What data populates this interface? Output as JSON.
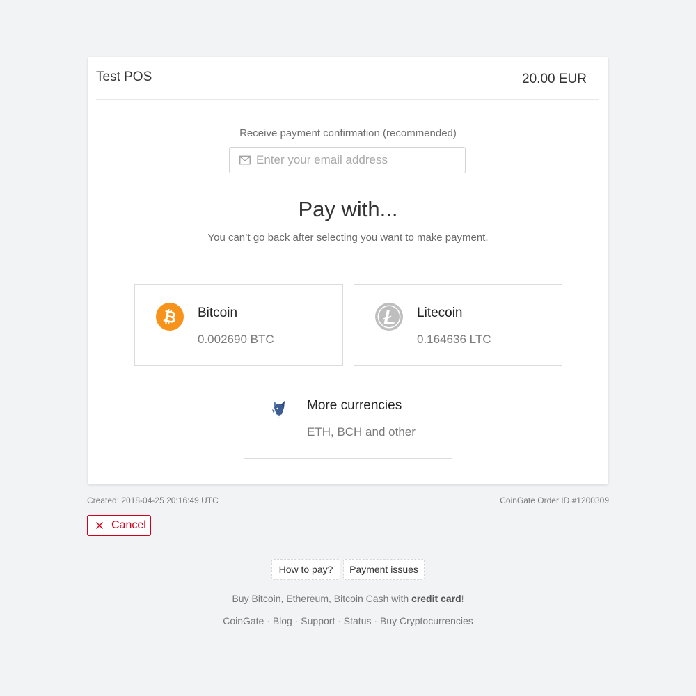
{
  "header": {
    "merchant_name": "Test POS",
    "amount": "20.00 EUR"
  },
  "email": {
    "label": "Receive payment confirmation (recommended)",
    "placeholder": "Enter your email address",
    "value": ""
  },
  "pay": {
    "title": "Pay with...",
    "note": "You can’t go back after selecting you want to make payment."
  },
  "options": [
    {
      "name": "Bitcoin",
      "sub": "0.002690 BTC",
      "icon": "bitcoin-icon",
      "color": "#f7931a"
    },
    {
      "name": "Litecoin",
      "sub": "0.164636 LTC",
      "icon": "litecoin-icon",
      "color": "#bebebe"
    },
    {
      "name": "More currencies",
      "sub": "ETH, BCH and other",
      "icon": "fox-icon",
      "color": "#3d5d91"
    }
  ],
  "meta": {
    "created": "Created: 2018-04-25 20:16:49 UTC",
    "order_id": "CoinGate Order ID #1200309"
  },
  "cancel": {
    "label": "Cancel",
    "color": "#d0021b"
  },
  "help": {
    "how_to_pay": "How to pay?",
    "payment_issues": "Payment issues"
  },
  "promo": {
    "text_before": "Buy Bitcoin, Ethereum, Bitcoin Cash with ",
    "bold": "credit card",
    "text_after": "!"
  },
  "footer": {
    "links": [
      "CoinGate",
      "Blog",
      "Support",
      "Status",
      "Buy Cryptocurrencies"
    ],
    "separator": "·"
  }
}
